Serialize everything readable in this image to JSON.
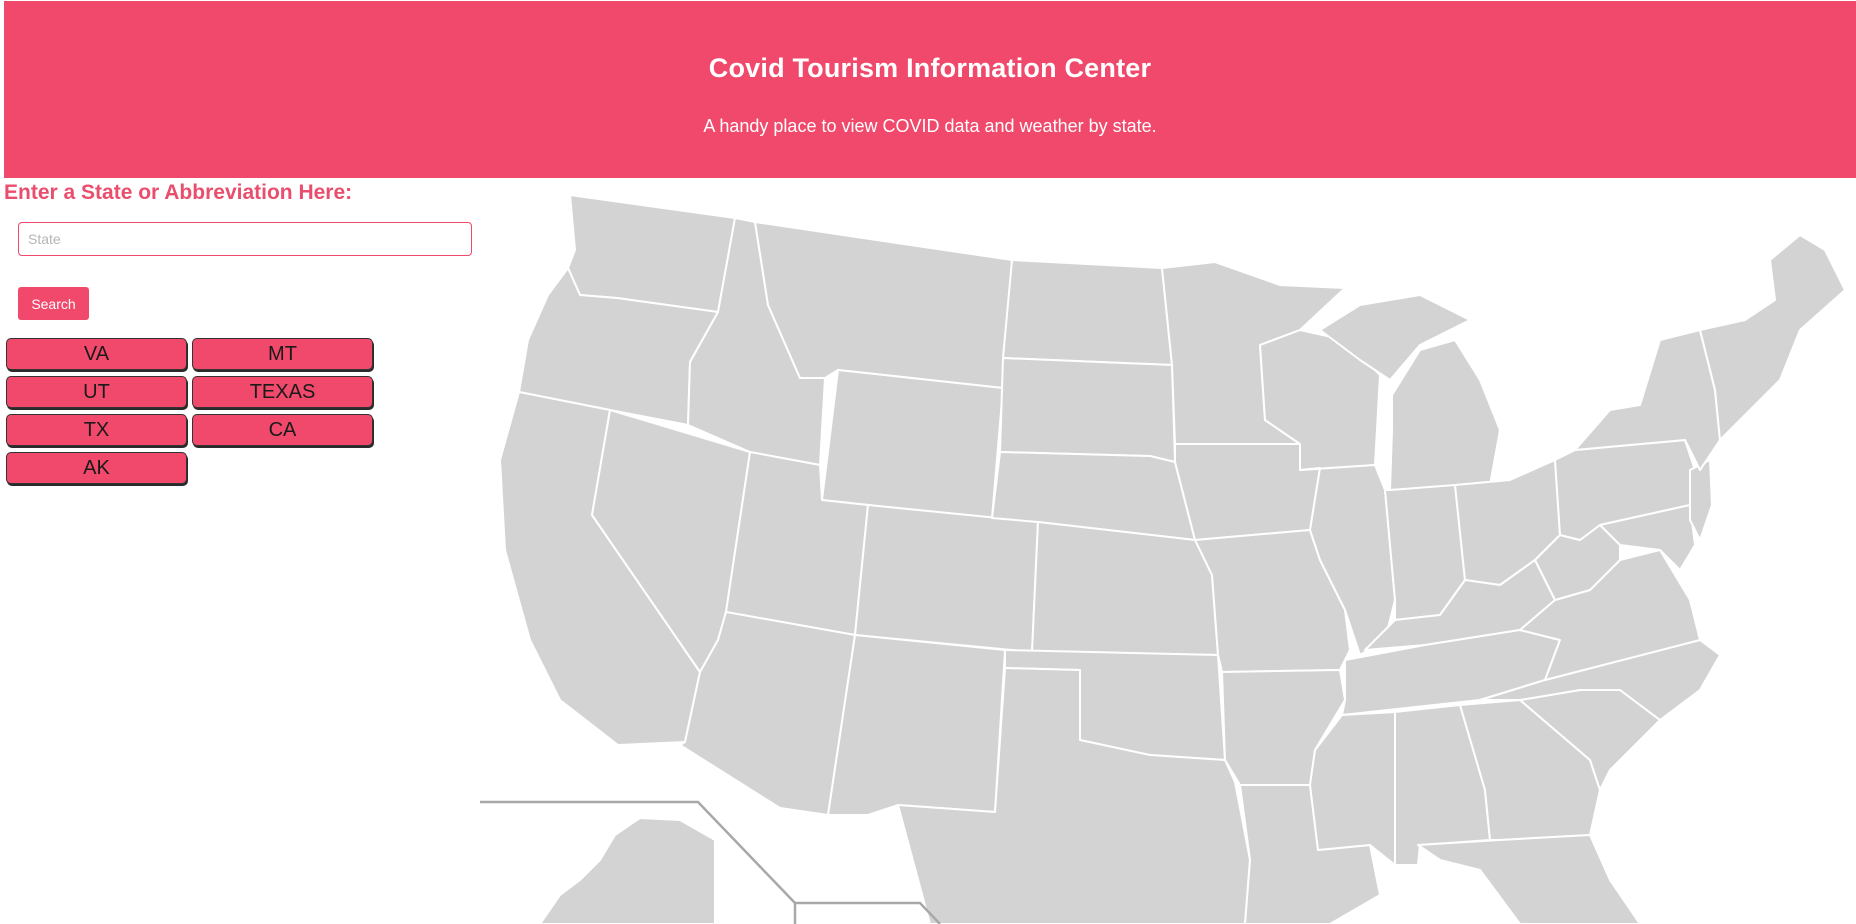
{
  "header": {
    "title": "Covid Tourism Information Center",
    "subtitle": "A handy place to view COVID data and weather by state."
  },
  "search": {
    "prompt": "Enter a State or Abbreviation Here:",
    "placeholder": "State",
    "value": "",
    "button_label": "Search"
  },
  "history": [
    "VA",
    "MT",
    "UT",
    "TEXAS",
    "TX",
    "CA",
    "AK"
  ],
  "map": {
    "fill_color": "#d3d3d3",
    "border_color": "#ffffff"
  },
  "colors": {
    "accent": "#f0496b",
    "prompt_text": "#e94e6d"
  }
}
